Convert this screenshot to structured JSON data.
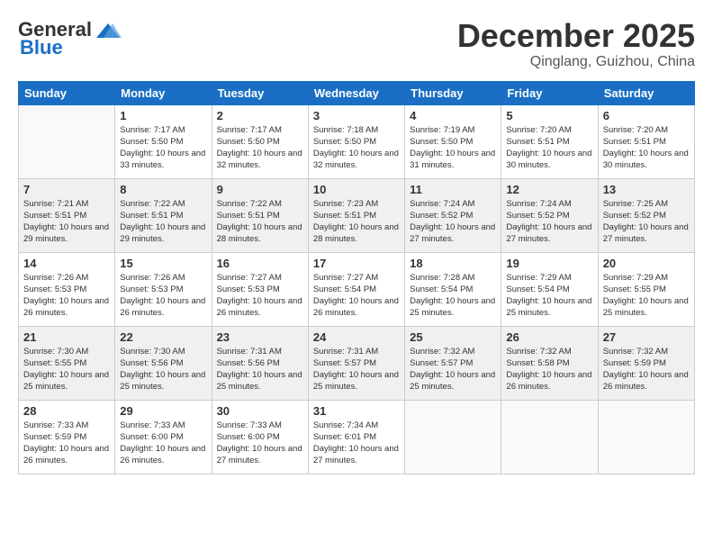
{
  "header": {
    "logo_general": "General",
    "logo_blue": "Blue",
    "month_title": "December 2025",
    "location": "Qinglang, Guizhou, China"
  },
  "days_of_week": [
    "Sunday",
    "Monday",
    "Tuesday",
    "Wednesday",
    "Thursday",
    "Friday",
    "Saturday"
  ],
  "weeks": [
    [
      {
        "day": "",
        "sunrise": "",
        "sunset": "",
        "daylight": ""
      },
      {
        "day": "1",
        "sunrise": "Sunrise: 7:17 AM",
        "sunset": "Sunset: 5:50 PM",
        "daylight": "Daylight: 10 hours and 33 minutes."
      },
      {
        "day": "2",
        "sunrise": "Sunrise: 7:17 AM",
        "sunset": "Sunset: 5:50 PM",
        "daylight": "Daylight: 10 hours and 32 minutes."
      },
      {
        "day": "3",
        "sunrise": "Sunrise: 7:18 AM",
        "sunset": "Sunset: 5:50 PM",
        "daylight": "Daylight: 10 hours and 32 minutes."
      },
      {
        "day": "4",
        "sunrise": "Sunrise: 7:19 AM",
        "sunset": "Sunset: 5:50 PM",
        "daylight": "Daylight: 10 hours and 31 minutes."
      },
      {
        "day": "5",
        "sunrise": "Sunrise: 7:20 AM",
        "sunset": "Sunset: 5:51 PM",
        "daylight": "Daylight: 10 hours and 30 minutes."
      },
      {
        "day": "6",
        "sunrise": "Sunrise: 7:20 AM",
        "sunset": "Sunset: 5:51 PM",
        "daylight": "Daylight: 10 hours and 30 minutes."
      }
    ],
    [
      {
        "day": "7",
        "sunrise": "Sunrise: 7:21 AM",
        "sunset": "Sunset: 5:51 PM",
        "daylight": "Daylight: 10 hours and 29 minutes."
      },
      {
        "day": "8",
        "sunrise": "Sunrise: 7:22 AM",
        "sunset": "Sunset: 5:51 PM",
        "daylight": "Daylight: 10 hours and 29 minutes."
      },
      {
        "day": "9",
        "sunrise": "Sunrise: 7:22 AM",
        "sunset": "Sunset: 5:51 PM",
        "daylight": "Daylight: 10 hours and 28 minutes."
      },
      {
        "day": "10",
        "sunrise": "Sunrise: 7:23 AM",
        "sunset": "Sunset: 5:51 PM",
        "daylight": "Daylight: 10 hours and 28 minutes."
      },
      {
        "day": "11",
        "sunrise": "Sunrise: 7:24 AM",
        "sunset": "Sunset: 5:52 PM",
        "daylight": "Daylight: 10 hours and 27 minutes."
      },
      {
        "day": "12",
        "sunrise": "Sunrise: 7:24 AM",
        "sunset": "Sunset: 5:52 PM",
        "daylight": "Daylight: 10 hours and 27 minutes."
      },
      {
        "day": "13",
        "sunrise": "Sunrise: 7:25 AM",
        "sunset": "Sunset: 5:52 PM",
        "daylight": "Daylight: 10 hours and 27 minutes."
      }
    ],
    [
      {
        "day": "14",
        "sunrise": "Sunrise: 7:26 AM",
        "sunset": "Sunset: 5:53 PM",
        "daylight": "Daylight: 10 hours and 26 minutes."
      },
      {
        "day": "15",
        "sunrise": "Sunrise: 7:26 AM",
        "sunset": "Sunset: 5:53 PM",
        "daylight": "Daylight: 10 hours and 26 minutes."
      },
      {
        "day": "16",
        "sunrise": "Sunrise: 7:27 AM",
        "sunset": "Sunset: 5:53 PM",
        "daylight": "Daylight: 10 hours and 26 minutes."
      },
      {
        "day": "17",
        "sunrise": "Sunrise: 7:27 AM",
        "sunset": "Sunset: 5:54 PM",
        "daylight": "Daylight: 10 hours and 26 minutes."
      },
      {
        "day": "18",
        "sunrise": "Sunrise: 7:28 AM",
        "sunset": "Sunset: 5:54 PM",
        "daylight": "Daylight: 10 hours and 25 minutes."
      },
      {
        "day": "19",
        "sunrise": "Sunrise: 7:29 AM",
        "sunset": "Sunset: 5:54 PM",
        "daylight": "Daylight: 10 hours and 25 minutes."
      },
      {
        "day": "20",
        "sunrise": "Sunrise: 7:29 AM",
        "sunset": "Sunset: 5:55 PM",
        "daylight": "Daylight: 10 hours and 25 minutes."
      }
    ],
    [
      {
        "day": "21",
        "sunrise": "Sunrise: 7:30 AM",
        "sunset": "Sunset: 5:55 PM",
        "daylight": "Daylight: 10 hours and 25 minutes."
      },
      {
        "day": "22",
        "sunrise": "Sunrise: 7:30 AM",
        "sunset": "Sunset: 5:56 PM",
        "daylight": "Daylight: 10 hours and 25 minutes."
      },
      {
        "day": "23",
        "sunrise": "Sunrise: 7:31 AM",
        "sunset": "Sunset: 5:56 PM",
        "daylight": "Daylight: 10 hours and 25 minutes."
      },
      {
        "day": "24",
        "sunrise": "Sunrise: 7:31 AM",
        "sunset": "Sunset: 5:57 PM",
        "daylight": "Daylight: 10 hours and 25 minutes."
      },
      {
        "day": "25",
        "sunrise": "Sunrise: 7:32 AM",
        "sunset": "Sunset: 5:57 PM",
        "daylight": "Daylight: 10 hours and 25 minutes."
      },
      {
        "day": "26",
        "sunrise": "Sunrise: 7:32 AM",
        "sunset": "Sunset: 5:58 PM",
        "daylight": "Daylight: 10 hours and 26 minutes."
      },
      {
        "day": "27",
        "sunrise": "Sunrise: 7:32 AM",
        "sunset": "Sunset: 5:59 PM",
        "daylight": "Daylight: 10 hours and 26 minutes."
      }
    ],
    [
      {
        "day": "28",
        "sunrise": "Sunrise: 7:33 AM",
        "sunset": "Sunset: 5:59 PM",
        "daylight": "Daylight: 10 hours and 26 minutes."
      },
      {
        "day": "29",
        "sunrise": "Sunrise: 7:33 AM",
        "sunset": "Sunset: 6:00 PM",
        "daylight": "Daylight: 10 hours and 26 minutes."
      },
      {
        "day": "30",
        "sunrise": "Sunrise: 7:33 AM",
        "sunset": "Sunset: 6:00 PM",
        "daylight": "Daylight: 10 hours and 27 minutes."
      },
      {
        "day": "31",
        "sunrise": "Sunrise: 7:34 AM",
        "sunset": "Sunset: 6:01 PM",
        "daylight": "Daylight: 10 hours and 27 minutes."
      },
      {
        "day": "",
        "sunrise": "",
        "sunset": "",
        "daylight": ""
      },
      {
        "day": "",
        "sunrise": "",
        "sunset": "",
        "daylight": ""
      },
      {
        "day": "",
        "sunrise": "",
        "sunset": "",
        "daylight": ""
      }
    ]
  ]
}
